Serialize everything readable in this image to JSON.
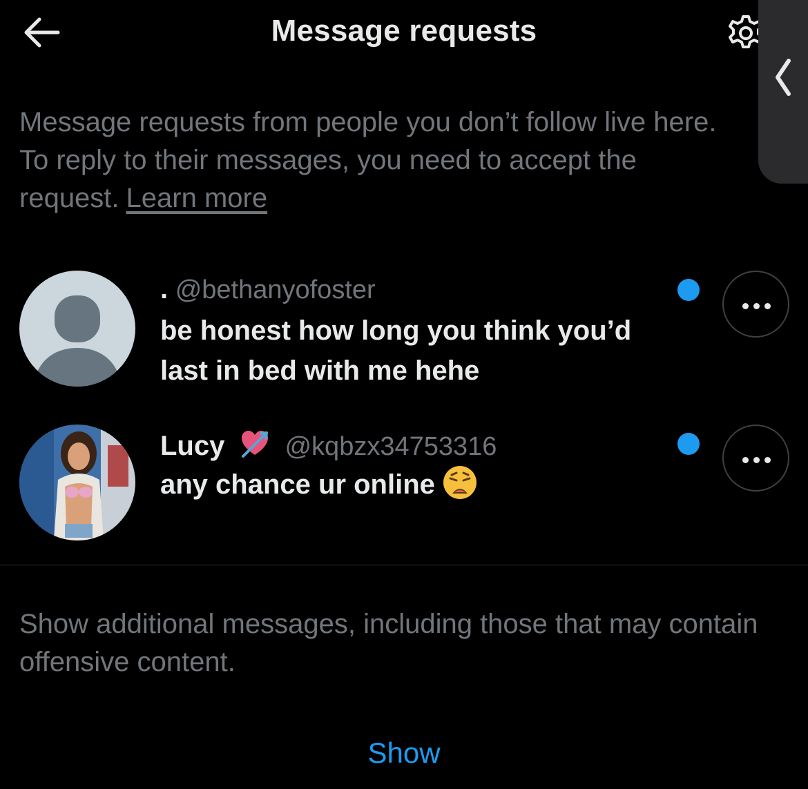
{
  "header": {
    "title": "Message requests",
    "back_icon": "arrow-left-icon",
    "settings_icon": "gear-icon"
  },
  "side_handle": {
    "icon": "chevron-left-icon"
  },
  "info": {
    "text": "Message requests from people you don’t follow live here. To reply to their messages, you need to accept the request.",
    "learn_more": "Learn more"
  },
  "conversations": [
    {
      "display_name": ".",
      "handle": "@bethanyofoster",
      "message": "be honest how long you think you’d last in bed with me hehe",
      "unread": true,
      "avatar": "default-avatar"
    },
    {
      "display_name": "Lucy",
      "name_emoji": "heart-with-arrow-emoji",
      "handle": "@kqbzx34753316",
      "message": "any chance ur online",
      "message_emoji": "weary-face-emoji",
      "unread": true,
      "avatar": "photo-avatar"
    }
  ],
  "additional": {
    "text": "Show additional messages, including those that may contain offensive content.",
    "show_label": "Show"
  },
  "colors": {
    "background": "#000000",
    "primary_text": "#e7e9ea",
    "secondary_text": "#71767b",
    "accent": "#1d9bf0",
    "border": "#2f3336"
  }
}
